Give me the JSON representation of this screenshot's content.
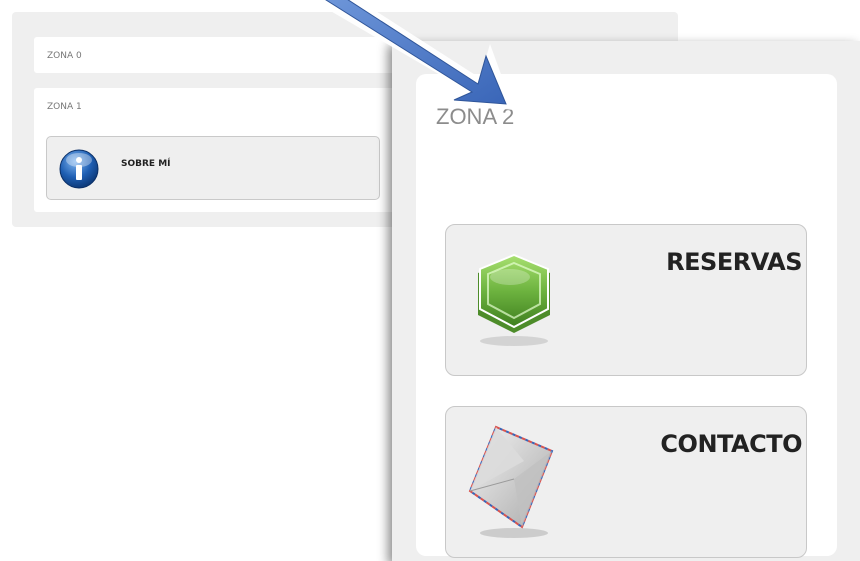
{
  "zones": {
    "zone0_label": "ZONA 0",
    "zone1_label": "ZONA 1",
    "zone2_label": "ZONA 2"
  },
  "cards": {
    "about_label": "SOBRE MÍ",
    "reservas_label": "RESERVAS",
    "contacto_label": "CONTACTO"
  },
  "icons": {
    "info": "info-icon",
    "reservas": "hexagon-icon",
    "contacto": "envelope-icon",
    "pointer": "arrow-icon"
  },
  "colors": {
    "panel_bg": "#efefef",
    "arrow_blue": "#4a76c4",
    "hexagon_green": "#6db33f",
    "info_blue": "#1f5fb3"
  }
}
